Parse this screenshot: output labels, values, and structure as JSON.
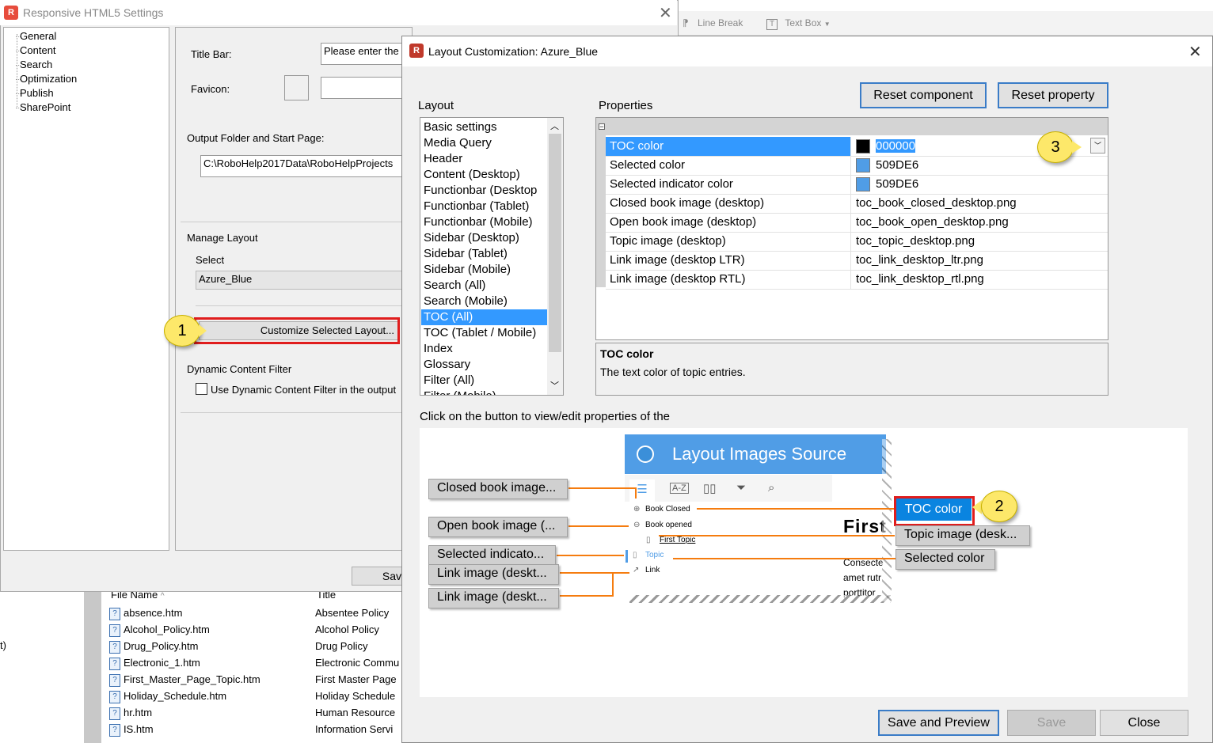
{
  "background": {
    "toolbar": {
      "line_break": "Line Break",
      "text_box": "Text Box"
    },
    "file_list": {
      "headers": {
        "file_name": "File Name",
        "title": "Title"
      },
      "rows": [
        {
          "file": "absence.htm",
          "title": "Absentee Policy"
        },
        {
          "file": "Alcohol_Policy.htm",
          "title": "Alcohol Policy"
        },
        {
          "file": "Drug_Policy.htm",
          "title": "Drug Policy"
        },
        {
          "file": "Electronic_1.htm",
          "title": "Electronic Commu"
        },
        {
          "file": "First_Master_Page_Topic.htm",
          "title": "First Master Page"
        },
        {
          "file": "Holiday_Schedule.htm",
          "title": "Holiday Schedule"
        },
        {
          "file": "hr.htm",
          "title": "Human Resource"
        },
        {
          "file": "IS.htm",
          "title": "Information Servi"
        }
      ],
      "left_fragment": "t)"
    }
  },
  "settings_dialog": {
    "title": "Responsive HTML5 Settings",
    "tree": [
      "General",
      "Content",
      "Search",
      "Optimization",
      "Publish",
      "SharePoint"
    ],
    "title_bar_label": "Title Bar:",
    "title_bar_value": "Please enter the",
    "favicon_label": "Favicon:",
    "output_label": "Output Folder and Start Page:",
    "output_value": "C:\\RoboHelp2017Data\\RoboHelpProjects",
    "manage_layout_label": "Manage Layout",
    "select_label": "Select",
    "select_value": "Azure_Blue",
    "customize_button": "Customize Selected Layout...",
    "dcf_label": "Dynamic Content Filter",
    "dcf_checkbox": "Use Dynamic Content Filter in the output",
    "save_button": "Sav"
  },
  "layout_dialog": {
    "title": "Layout Customization: Azure_Blue",
    "layout_label": "Layout",
    "properties_label": "Properties",
    "reset_component": "Reset component",
    "reset_property": "Reset property",
    "layout_items": [
      "Basic settings",
      "Media Query",
      "Header",
      "Content (Desktop)",
      "Functionbar (Desktop",
      "Functionbar (Tablet)",
      "Functionbar (Mobile)",
      "Sidebar (Desktop)",
      "Sidebar (Tablet)",
      "Sidebar (Mobile)",
      "Search (All)",
      "Search (Mobile)",
      "TOC (All)",
      "TOC (Tablet / Mobile)",
      "Index",
      "Glossary",
      "Filter (All)",
      "Filter (Mobile)"
    ],
    "selected_layout": "TOC (All)",
    "properties": [
      {
        "name": "TOC color",
        "value": "000000",
        "color": "#000000",
        "selected": true
      },
      {
        "name": "Selected color",
        "value": "509DE6",
        "color": "#509DE6"
      },
      {
        "name": "Selected indicator color",
        "value": "509DE6",
        "color": "#509DE6"
      },
      {
        "name": "Closed book image (desktop)",
        "value": "toc_book_closed_desktop.png"
      },
      {
        "name": "Open book image (desktop)",
        "value": "toc_book_open_desktop.png"
      },
      {
        "name": "Topic image (desktop)",
        "value": "toc_topic_desktop.png"
      },
      {
        "name": "Link image (desktop LTR)",
        "value": "toc_link_desktop_ltr.png"
      },
      {
        "name": "Link image (desktop RTL)",
        "value": "toc_link_desktop_rtl.png"
      }
    ],
    "description_title": "TOC color",
    "description_text": "The text color of topic entries.",
    "instruction": "Click on the button to view/edit properties of the",
    "buttons": {
      "save_preview": "Save and Preview",
      "save": "Save",
      "close": "Close"
    }
  },
  "preview": {
    "header_title": "Layout Images Source",
    "toc_items": [
      "Book Closed",
      "Book opened",
      "First Topic",
      "Topic",
      "Link"
    ],
    "content_heading": "First",
    "content_text": [
      "Consecte",
      "amet rutr",
      "porttitor"
    ],
    "left_buttons": [
      "Closed book image...",
      "Open book image (...",
      "Selected indicato...",
      "Link image (deskt...",
      "Link image (deskt..."
    ],
    "right_buttons": {
      "toc_color": "TOC color",
      "topic_image": "Topic image (desk...",
      "selected_color": "Selected color"
    },
    "accent_color": "#509DE6",
    "arrow_color": "#F57C0F"
  },
  "callouts": [
    "1",
    "2",
    "3"
  ]
}
